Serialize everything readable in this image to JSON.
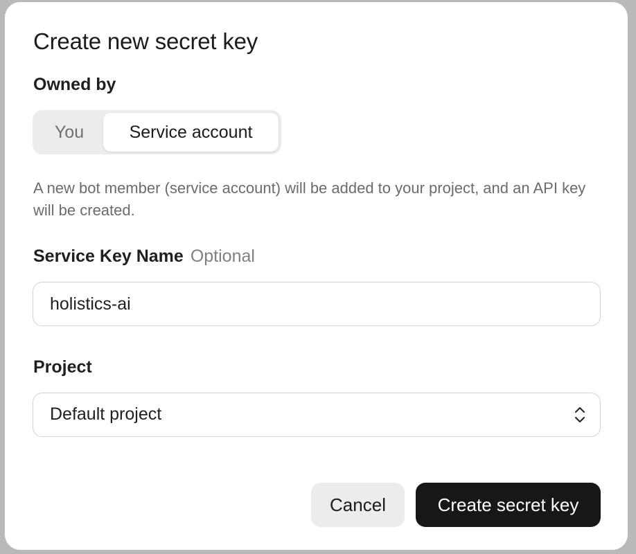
{
  "dialog": {
    "title": "Create new secret key",
    "owned_by": {
      "label": "Owned by",
      "options": [
        "You",
        "Service account"
      ],
      "selected": "Service account"
    },
    "description": "A new bot member (service account) will be added to your project, and an API key will be created.",
    "service_key_name": {
      "label": "Service Key Name",
      "optional_text": "Optional",
      "value": "holistics-ai"
    },
    "project": {
      "label": "Project",
      "selected": "Default project",
      "icon": "chevron-up-down-icon"
    },
    "actions": {
      "cancel_label": "Cancel",
      "create_label": "Create secret key"
    }
  },
  "colors": {
    "primary_button_bg": "#171717",
    "secondary_button_bg": "#ececec",
    "segmented_bg": "#ececec",
    "backdrop": "#b9b9b9"
  }
}
